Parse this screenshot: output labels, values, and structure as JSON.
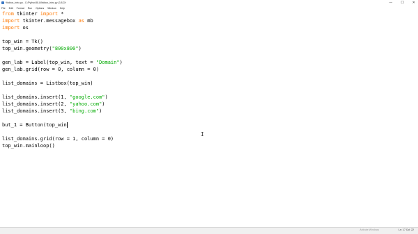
{
  "window": {
    "title": "*listbox_intro.py - C:/Python38-8/listbox_intro.py (3.8.2)*",
    "minimize_glyph": "—",
    "maximize_glyph": "☐",
    "close_glyph": "✕",
    "app_icon": "python-idle-icon"
  },
  "menu": {
    "items": [
      "File",
      "Edit",
      "Format",
      "Run",
      "Options",
      "Window",
      "Help"
    ]
  },
  "editor": {
    "lines": [
      {
        "segments": [
          {
            "t": "from",
            "c": "kw"
          },
          {
            "t": " tkinter ",
            "c": "plain"
          },
          {
            "t": "import",
            "c": "kw"
          },
          {
            "t": " *",
            "c": "plain"
          }
        ]
      },
      {
        "segments": [
          {
            "t": "import",
            "c": "kw"
          },
          {
            "t": " tkinter.messagebox ",
            "c": "plain"
          },
          {
            "t": "as",
            "c": "kw"
          },
          {
            "t": " mb",
            "c": "plain"
          }
        ]
      },
      {
        "segments": [
          {
            "t": "import",
            "c": "kw"
          },
          {
            "t": " os",
            "c": "plain"
          }
        ]
      },
      {
        "segments": []
      },
      {
        "segments": [
          {
            "t": "top_win = Tk()",
            "c": "plain"
          }
        ]
      },
      {
        "segments": [
          {
            "t": "top_win.geometry(",
            "c": "plain"
          },
          {
            "t": "\"800x800\"",
            "c": "str"
          },
          {
            "t": ")",
            "c": "plain"
          }
        ]
      },
      {
        "segments": []
      },
      {
        "segments": [
          {
            "t": "gen_lab = Label(top_win, text = ",
            "c": "plain"
          },
          {
            "t": "\"Domain\"",
            "c": "str"
          },
          {
            "t": ")",
            "c": "plain"
          }
        ]
      },
      {
        "segments": [
          {
            "t": "gen_lab.grid(row = 0, column = 0)",
            "c": "plain"
          }
        ]
      },
      {
        "segments": []
      },
      {
        "segments": [
          {
            "t": "list_domains = Listbox(top_win)",
            "c": "plain"
          }
        ]
      },
      {
        "segments": []
      },
      {
        "segments": [
          {
            "t": "list_domains.insert(1, ",
            "c": "plain"
          },
          {
            "t": "\"google.com\"",
            "c": "str"
          },
          {
            "t": ")",
            "c": "plain"
          }
        ]
      },
      {
        "segments": [
          {
            "t": "list_domains.insert(2, ",
            "c": "plain"
          },
          {
            "t": "\"yahoo.com\"",
            "c": "str"
          },
          {
            "t": ")",
            "c": "plain"
          }
        ]
      },
      {
        "segments": [
          {
            "t": "list_domains.insert(3, ",
            "c": "plain"
          },
          {
            "t": "\"bing.com\"",
            "c": "str"
          },
          {
            "t": ")",
            "c": "plain"
          }
        ]
      },
      {
        "segments": []
      },
      {
        "segments": [
          {
            "t": "but_1 = Button(top_win",
            "c": "plain"
          }
        ]
      },
      {
        "segments": []
      },
      {
        "segments": [
          {
            "t": "list_domains.grid(row = 1, column = 0)",
            "c": "plain"
          }
        ]
      },
      {
        "segments": [
          {
            "t": "top_win.mainloop()",
            "c": "plain"
          }
        ]
      }
    ],
    "caret_line_index": 16,
    "pointer_icon": "text-cursor-ibeam-icon",
    "pointer_glyph": "I"
  },
  "statusbar": {
    "watermark": "Activate Windows",
    "position": "Ln: 17   Col: 22"
  },
  "colors": {
    "keyword": "#ff7700",
    "string": "#00aa00",
    "text": "#000000",
    "background": "#ffffff"
  }
}
